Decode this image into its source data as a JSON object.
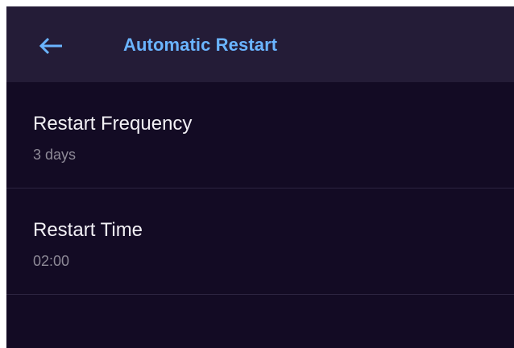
{
  "header": {
    "title": "Automatic Restart",
    "back_icon": "arrow-left-icon",
    "accent_color": "#6ab4ff"
  },
  "settings": [
    {
      "label": "Restart Frequency",
      "value": "3 days"
    },
    {
      "label": "Restart Time",
      "value": "02:00"
    }
  ],
  "colors": {
    "background": "#130b24",
    "header_background": "#241c37",
    "divider": "#2c2440",
    "primary_text": "#f2f0f5",
    "secondary_text": "#8e8a97"
  }
}
